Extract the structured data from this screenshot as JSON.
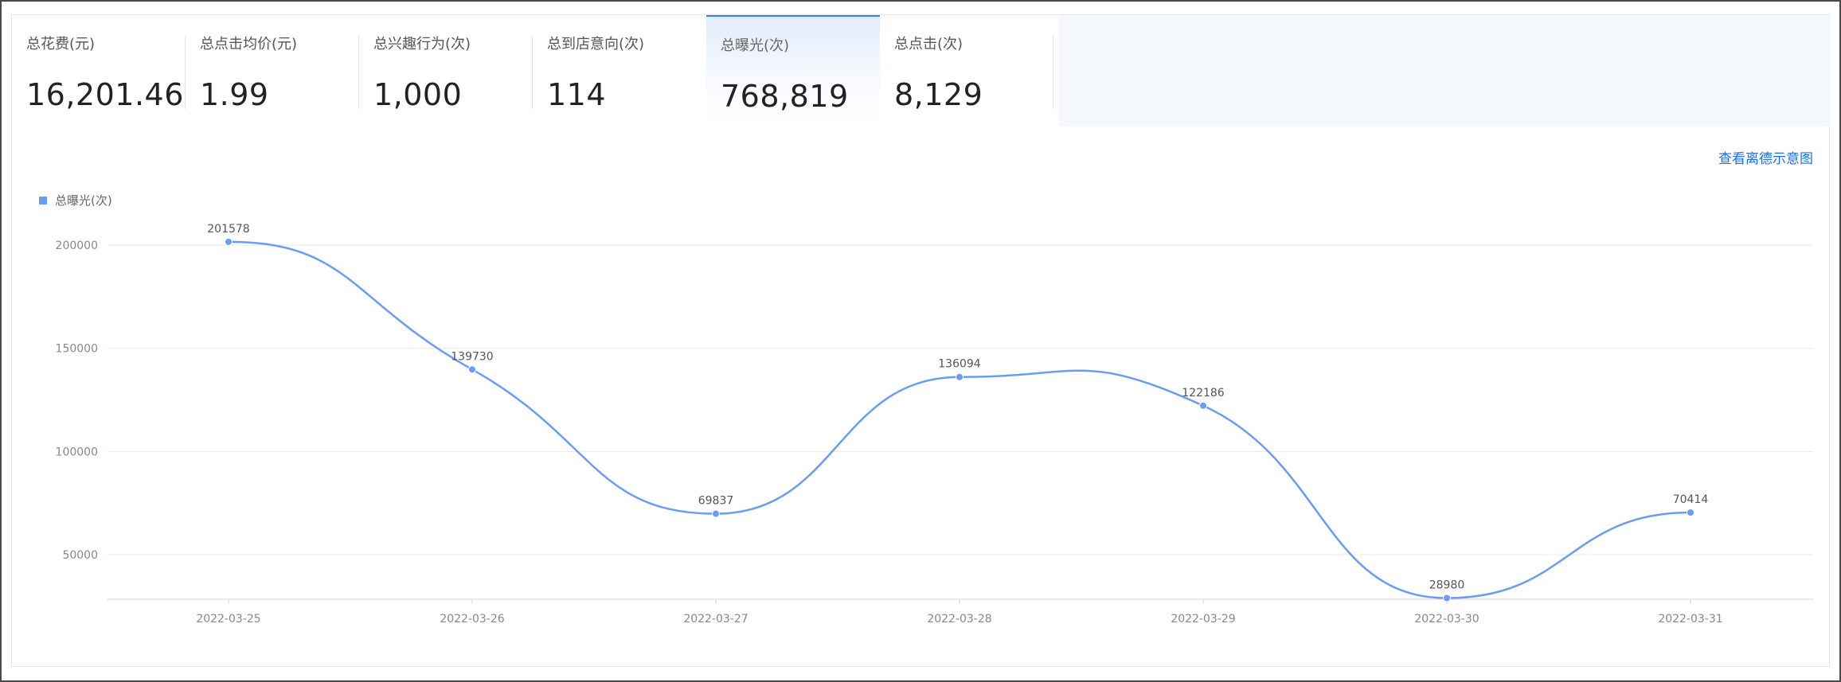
{
  "metrics": [
    {
      "label": "总花费(元)",
      "value": "16,201.46"
    },
    {
      "label": "总点击均价(元)",
      "value": "1.99"
    },
    {
      "label": "总兴趣行为(次)",
      "value": "1,000"
    },
    {
      "label": "总到店意向(次)",
      "value": "114"
    },
    {
      "label": "总曝光(次)",
      "value": "768,819"
    },
    {
      "label": "总点击(次)",
      "value": "8,129"
    }
  ],
  "active_metric": "总曝光(次)",
  "detail_link": "查看离德示意图",
  "colors": {
    "accent": "#3c7ff0",
    "series": "#6b9cf5",
    "link": "#1f6fe0"
  },
  "chart_data": {
    "type": "line",
    "smooth": true,
    "legend": "top-left",
    "grid": true,
    "categories": [
      "2022-03-25",
      "2022-03-26",
      "2022-03-27",
      "2022-03-28",
      "2022-03-29",
      "2022-03-30",
      "2022-03-31"
    ],
    "series": [
      {
        "name": "总曝光(次)",
        "values": [
          201578,
          139730,
          69837,
          136094,
          122186,
          28980,
          70414
        ]
      }
    ],
    "yticks": [
      "200000",
      "150000",
      "100000",
      "50000"
    ],
    "ylim": [
      28000,
      225000
    ]
  }
}
